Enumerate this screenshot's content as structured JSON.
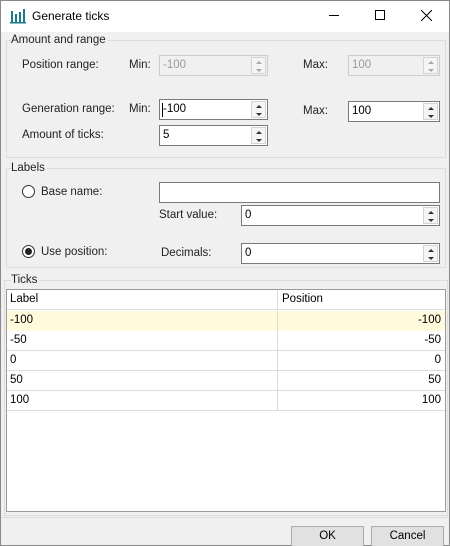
{
  "window": {
    "title": "Generate ticks",
    "icon": "chart-icon",
    "controls": [
      "minimize-icon",
      "maximize-icon",
      "close-icon"
    ]
  },
  "amount_range": {
    "group_label": "Amount and range",
    "position_range_label": "Position range:",
    "position_min_label": "Min:",
    "position_min_value": "-100",
    "position_max_label": "Max:",
    "position_max_value": "100",
    "generation_range_label": "Generation range:",
    "generation_min_label": "Min:",
    "generation_min_value": "-100",
    "generation_max_label": "Max:",
    "generation_max_value": "100",
    "amount_label": "Amount of ticks:",
    "amount_value": "5"
  },
  "labels": {
    "group_label": "Labels",
    "base_name_label": "Base name:",
    "base_name_value": "",
    "start_value_label": "Start value:",
    "start_value": "0",
    "use_position_label": "Use position:",
    "decimals_label": "Decimals:",
    "decimals_value": "0",
    "selected_option": "Use position"
  },
  "ticks": {
    "group_label": "Ticks",
    "columns": [
      "Label",
      "Position"
    ],
    "rows": [
      {
        "label": "-100",
        "position": "-100"
      },
      {
        "label": "-50",
        "position": "-50"
      },
      {
        "label": "0",
        "position": "0"
      },
      {
        "label": "50",
        "position": "50"
      },
      {
        "label": "100",
        "position": "100"
      }
    ]
  },
  "buttons": {
    "ok": "OK",
    "cancel": "Cancel"
  },
  "colors": {
    "selected_row": "#fffbdc",
    "app_icon": "#1b7a8c"
  }
}
